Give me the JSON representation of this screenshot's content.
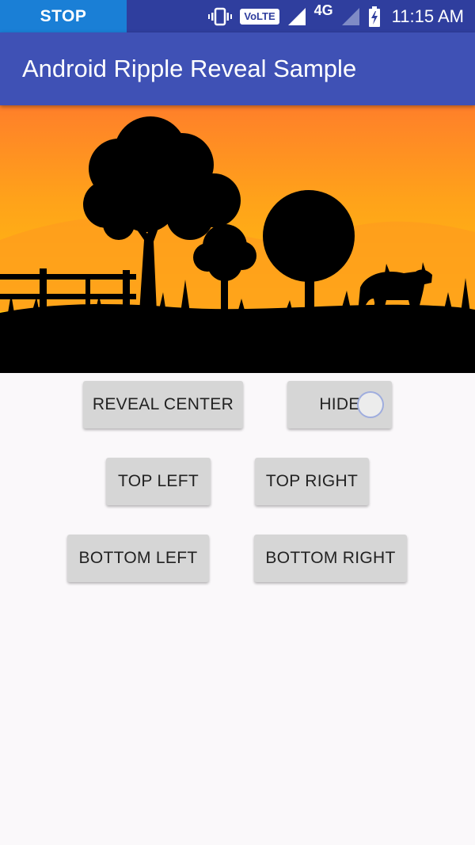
{
  "status_bar": {
    "stop_label": "STOP",
    "volte_label": "VoLTE",
    "network_label": "4G",
    "time": "11:15 AM",
    "icons": [
      "vibrate-icon",
      "volte-icon",
      "signal-icon",
      "network-icon",
      "signal-weak-icon",
      "battery-charging-icon"
    ]
  },
  "app_bar": {
    "title": "Android Ripple Reveal Sample"
  },
  "hero": {
    "icon": "sunset-landscape-image"
  },
  "buttons": {
    "reveal_center": "REVEAL CENTER",
    "hide": "HIDE",
    "top_left": "TOP LEFT",
    "top_right": "TOP RIGHT",
    "bottom_left": "BOTTOM LEFT",
    "bottom_right": "BOTTOM RIGHT"
  },
  "colors": {
    "status_bar": "#2f3e9e",
    "stop_pill": "#1a7fd6",
    "app_bar": "#3f51b5",
    "button_bg": "#d6d6d6",
    "background": "#faf8fa"
  }
}
